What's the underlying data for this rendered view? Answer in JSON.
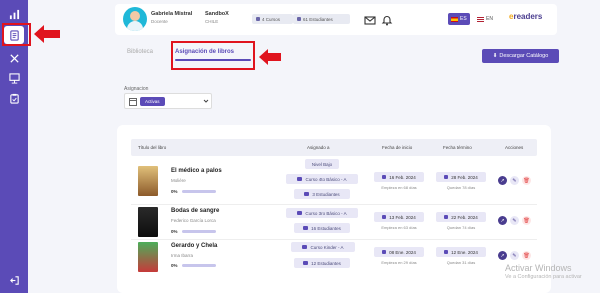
{
  "sidebar": {
    "items": [
      {
        "icon": "bar-chart-icon"
      },
      {
        "icon": "book-list-icon",
        "active": true
      },
      {
        "icon": "tools-icon"
      },
      {
        "icon": "presentation-icon"
      },
      {
        "icon": "clipboard-icon"
      }
    ],
    "logout_icon": "logout-icon"
  },
  "header": {
    "user_name": "Gabriela Mistral",
    "user_role": "Docente",
    "school_name": "SandboX",
    "school_country": "CHILE",
    "courses_label": "4 Cursos",
    "students_label": "61 Estudiantes",
    "lang_es": "ES",
    "lang_en": "EN",
    "logo_text": "readers",
    "logo_prefix": "e"
  },
  "tabs": {
    "library": "Biblioteca",
    "assignment": "Asignación de libros"
  },
  "download_button": "Descargar Catálogo",
  "filter": {
    "label": "Asignacion",
    "value": "Activas"
  },
  "table": {
    "headers": {
      "title": "Título del libro",
      "assigned_to": "Asignado a",
      "start_date": "Fecha de inicio",
      "end_date": "Fecha término",
      "actions": "Acciones"
    },
    "rows": [
      {
        "title": "El médico a palos",
        "author": "Molière",
        "progress": "0%",
        "level": "Nivel Bajo",
        "course": "Curso 4to Básico - A",
        "students": "3 Estudiantes",
        "start": "16 Feb. 2024",
        "start_sub": "Empieza en 68 días",
        "end": "28 Feb. 2024",
        "end_sub": "Quedan 78 días",
        "cover_color": "#c9a46a"
      },
      {
        "title": "Bodas de sangre",
        "author": "Federico García Lorca",
        "progress": "0%",
        "level": "",
        "course": "Curso 3ro Básico - A",
        "students": "16 Estudiantes",
        "start": "13 Feb. 2024",
        "start_sub": "Empieza en 63 días",
        "end": "22 Feb. 2024",
        "end_sub": "Quedan 74 días",
        "cover_color": "#1b1b1b"
      },
      {
        "title": "Gerardo y Chela",
        "author": "Irma Ibarra",
        "progress": "0%",
        "level": "",
        "course": "Curso Kinder - A",
        "students": "12 Estudiantes",
        "start": "08 Ene. 2024",
        "start_sub": "Empieza en 29 días",
        "end": "12 Ene. 2024",
        "end_sub": "Quedan 31 días",
        "cover_color": "#3a8f4a"
      }
    ]
  },
  "watermark": {
    "title": "Activar Windows",
    "subtitle": "Ve a Configuración para activar"
  },
  "colors": {
    "primary": "#5b4bb7",
    "highlight": "#e0141e",
    "accent": "#f0a91c"
  }
}
